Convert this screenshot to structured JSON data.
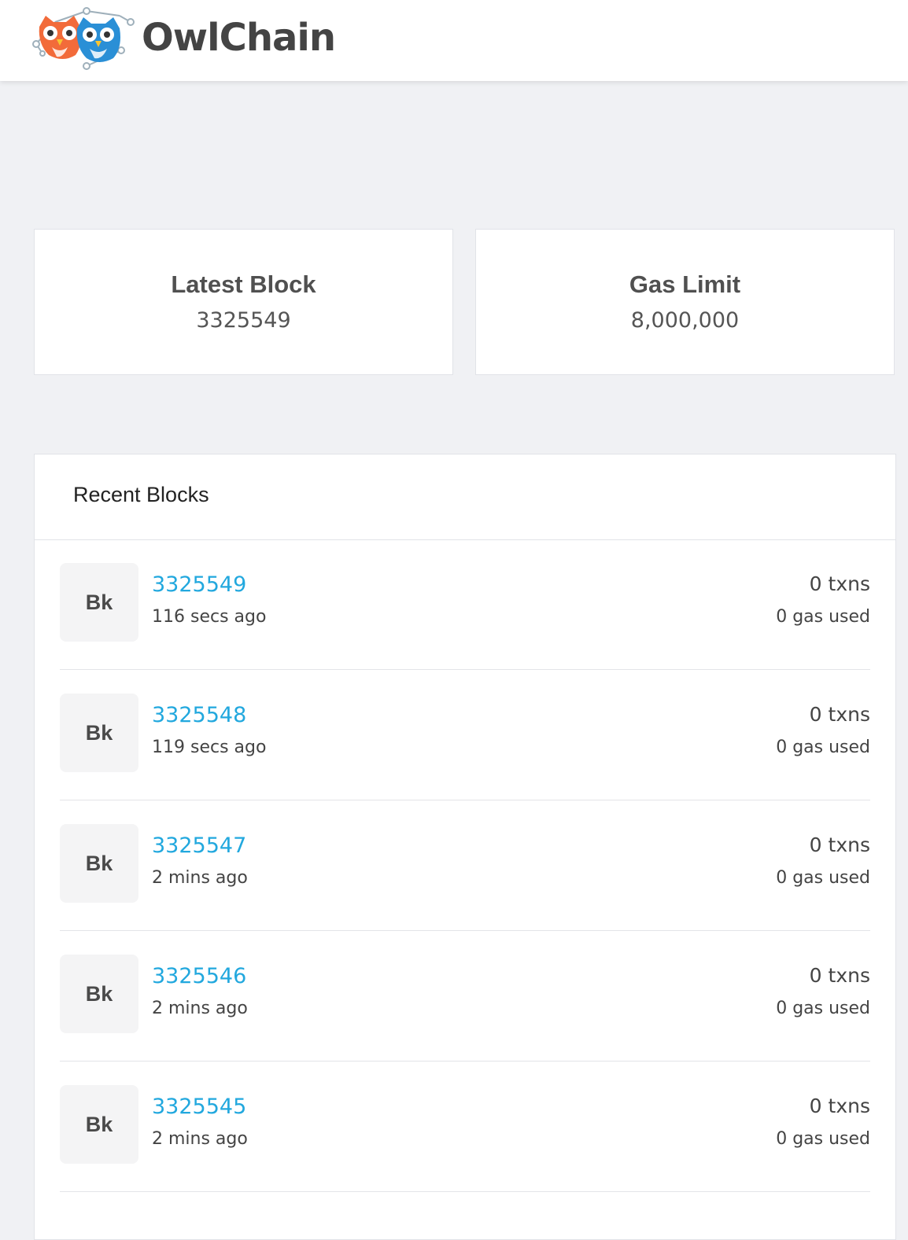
{
  "header": {
    "brand": "OwlChain",
    "logo_icon": "owl-pair-logo-icon"
  },
  "stats": {
    "latest_block": {
      "title": "Latest Block",
      "value": "3325549"
    },
    "gas_limit": {
      "title": "Gas Limit",
      "value": "8,000,000"
    }
  },
  "recent_blocks": {
    "title": "Recent Blocks",
    "rows": [
      {
        "badge": "Bk",
        "number": "3325549",
        "age": "116 secs ago",
        "txns": "0 txns",
        "gas": "0 gas used"
      },
      {
        "badge": "Bk",
        "number": "3325548",
        "age": "119 secs ago",
        "txns": "0 txns",
        "gas": "0 gas used"
      },
      {
        "badge": "Bk",
        "number": "3325547",
        "age": "2 mins ago",
        "txns": "0 txns",
        "gas": "0 gas used"
      },
      {
        "badge": "Bk",
        "number": "3325546",
        "age": "2 mins ago",
        "txns": "0 txns",
        "gas": "0 gas used"
      },
      {
        "badge": "Bk",
        "number": "3325545",
        "age": "2 mins ago",
        "txns": "0 txns",
        "gas": "0 gas used"
      }
    ]
  },
  "colors": {
    "link": "#22a8de",
    "background": "#f0f1f4",
    "owl_orange": "#f26b3a",
    "owl_blue": "#2a8fd6"
  }
}
